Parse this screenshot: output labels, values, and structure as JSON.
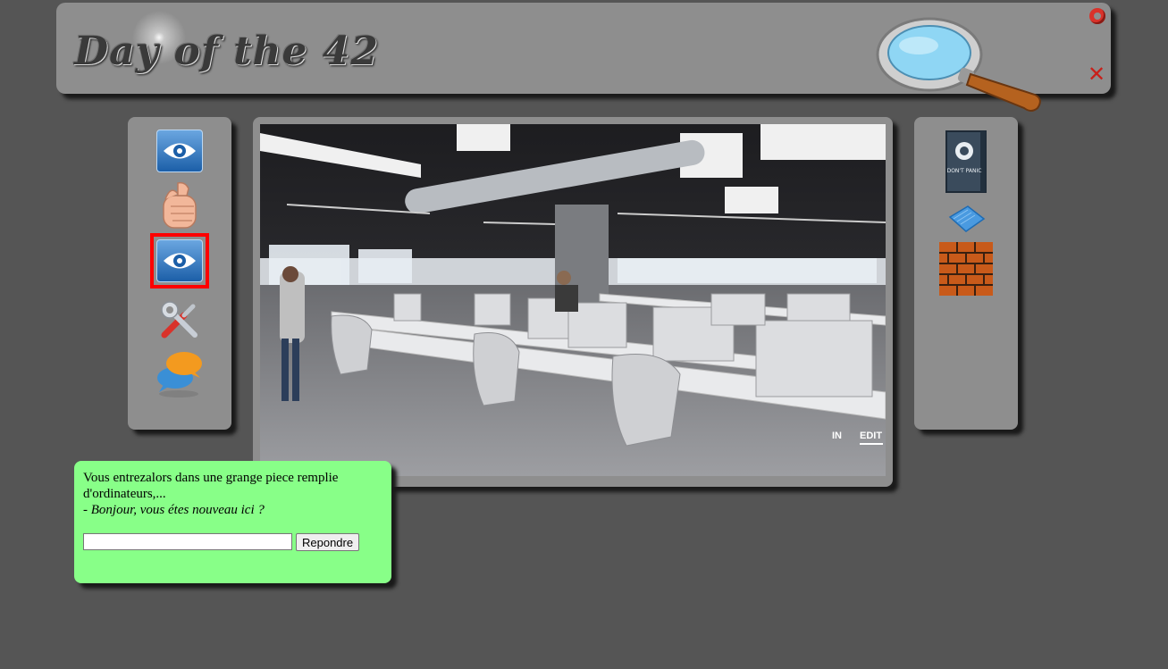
{
  "header": {
    "logo_text": "Day of the 42",
    "refresh_icon": "refresh-icon",
    "close_label": "✕"
  },
  "toolbar": {
    "items": [
      {
        "icon": "eye-icon",
        "selected": false
      },
      {
        "icon": "fist-icon",
        "selected": false
      },
      {
        "icon": "eye-icon",
        "selected": true
      },
      {
        "icon": "tools-icon",
        "selected": false
      },
      {
        "icon": "chat-bubble-icon",
        "selected": false
      }
    ]
  },
  "scene": {
    "watermark_in": "IN",
    "watermark_edit": "EDIT"
  },
  "inventory": {
    "items": [
      {
        "icon": "dont-panic-book-icon",
        "text": "DON'T PANIC"
      },
      {
        "icon": "towel-icon"
      },
      {
        "icon": "brick-wall-icon"
      }
    ]
  },
  "dialog": {
    "narration": "Vous entrezalors dans une grange piece remplie d'ordinateurs,...",
    "speech": "- Bonjour, vous étes nouveau ici ?",
    "input_value": "",
    "button_label": "Repondre"
  }
}
